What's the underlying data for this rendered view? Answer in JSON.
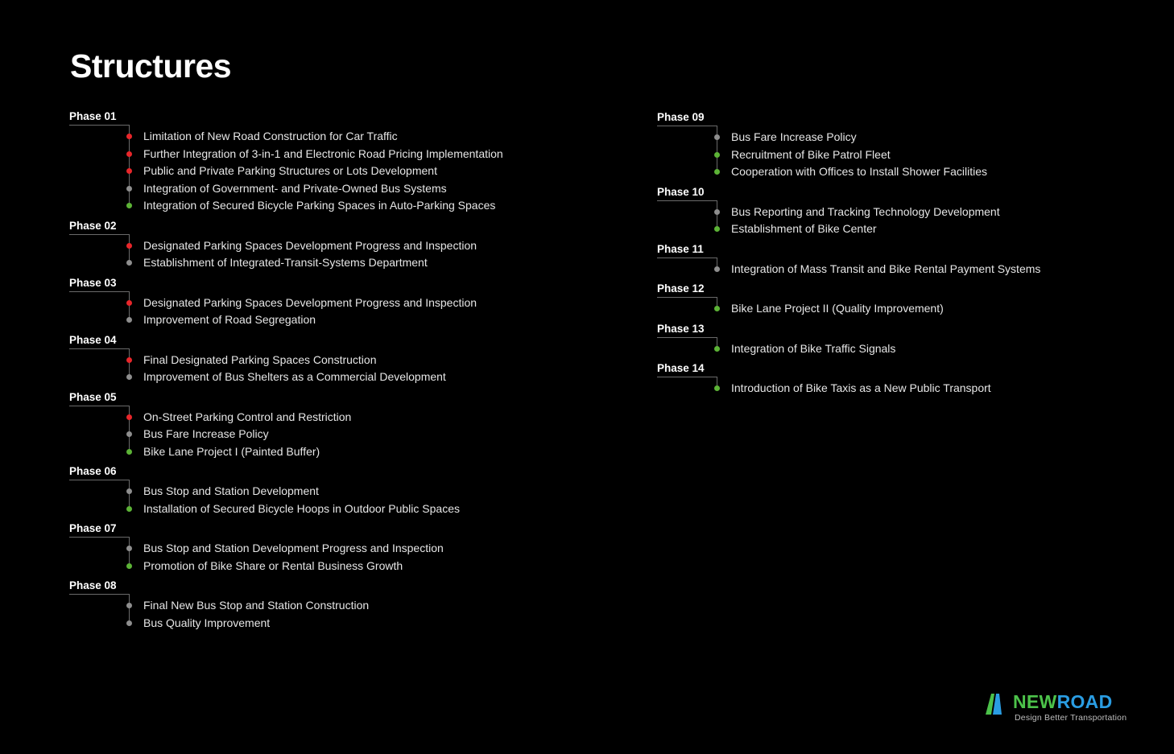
{
  "title": "Structures",
  "colors": {
    "red": "#e8262a",
    "grey": "#8e8e8e",
    "green": "#5cb336",
    "brand_green": "#4cc24a",
    "brand_blue": "#2a9de3"
  },
  "left_phases": [
    {
      "label": "Phase 01",
      "items": [
        {
          "text": "Limitation of New Road Construction for Car Traffic",
          "color": "red"
        },
        {
          "text": "Further Integration of 3-in-1 and Electronic Road Pricing Implementation",
          "color": "red"
        },
        {
          "text": "Public and Private Parking Structures or Lots Development",
          "color": "red"
        },
        {
          "text": "Integration of Government- and Private-Owned Bus Systems",
          "color": "grey"
        },
        {
          "text": "Integration of Secured Bicycle Parking Spaces in Auto-Parking Spaces",
          "color": "green"
        }
      ]
    },
    {
      "label": "Phase 02",
      "items": [
        {
          "text": "Designated Parking Spaces Development Progress and Inspection",
          "color": "red"
        },
        {
          "text": "Establishment of Integrated-Transit-Systems Department",
          "color": "grey"
        }
      ]
    },
    {
      "label": "Phase 03",
      "items": [
        {
          "text": "Designated Parking Spaces Development Progress and Inspection",
          "color": "red"
        },
        {
          "text": "Improvement of Road Segregation",
          "color": "grey"
        }
      ]
    },
    {
      "label": "Phase 04",
      "items": [
        {
          "text": "Final Designated Parking Spaces Construction",
          "color": "red"
        },
        {
          "text": "Improvement of Bus Shelters as a Commercial Development",
          "color": "grey"
        }
      ]
    },
    {
      "label": "Phase 05",
      "items": [
        {
          "text": "On-Street Parking Control and Restriction",
          "color": "red"
        },
        {
          "text": "Bus Fare Increase Policy",
          "color": "grey"
        },
        {
          "text": "Bike Lane Project I (Painted Buffer)",
          "color": "green"
        }
      ]
    },
    {
      "label": "Phase 06",
      "items": [
        {
          "text": "Bus Stop and Station Development",
          "color": "grey"
        },
        {
          "text": "Installation of Secured Bicycle Hoops in Outdoor Public Spaces",
          "color": "green"
        }
      ]
    },
    {
      "label": "Phase 07",
      "items": [
        {
          "text": "Bus Stop and Station Development Progress and Inspection",
          "color": "grey"
        },
        {
          "text": "Promotion of Bike Share or Rental Business Growth",
          "color": "green"
        }
      ]
    },
    {
      "label": "Phase 08",
      "items": [
        {
          "text": "Final New Bus Stop and Station Construction",
          "color": "grey"
        },
        {
          "text": "Bus Quality Improvement",
          "color": "grey"
        }
      ]
    }
  ],
  "right_phases": [
    {
      "label": "Phase 09",
      "items": [
        {
          "text": "Bus Fare Increase Policy",
          "color": "grey"
        },
        {
          "text": "Recruitment of Bike Patrol Fleet",
          "color": "green"
        },
        {
          "text": "Cooperation with Offices to Install Shower Facilities",
          "color": "green"
        }
      ]
    },
    {
      "label": "Phase 10",
      "items": [
        {
          "text": "Bus Reporting and Tracking Technology Development",
          "color": "grey"
        },
        {
          "text": "Establishment of Bike Center",
          "color": "green"
        }
      ]
    },
    {
      "label": "Phase 11",
      "items": [
        {
          "text": "Integration of Mass Transit and Bike Rental Payment Systems",
          "color": "grey"
        }
      ]
    },
    {
      "label": "Phase 12",
      "items": [
        {
          "text": "Bike Lane Project II (Quality Improvement)",
          "color": "green"
        }
      ]
    },
    {
      "label": "Phase 13",
      "items": [
        {
          "text": "Integration of Bike Traffic Signals",
          "color": "green"
        }
      ]
    },
    {
      "label": "Phase 14",
      "items": [
        {
          "text": "Introduction of Bike Taxis as a New Public Transport",
          "color": "green"
        }
      ]
    }
  ],
  "brand": {
    "name_part1": "NEW",
    "name_part2": "ROAD",
    "tagline": "Design Better Transportation",
    "icon": "road-logo-icon"
  }
}
